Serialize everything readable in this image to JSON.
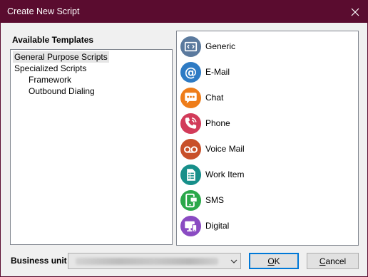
{
  "window": {
    "title": "Create New Script"
  },
  "templates_panel": {
    "header": "Available Templates",
    "tree": [
      {
        "label": "General Purpose Scripts",
        "selected": true,
        "level": 0
      },
      {
        "label": "Specialized Scripts",
        "selected": false,
        "level": 0
      },
      {
        "label": "Framework",
        "selected": false,
        "level": 1
      },
      {
        "label": "Outbound Dialing",
        "selected": false,
        "level": 1
      }
    ]
  },
  "template_list": [
    {
      "label": "Generic",
      "icon": "code-window-icon",
      "color": "#5b7a9e"
    },
    {
      "label": "E-Mail",
      "icon": "at-sign-icon",
      "color": "#2e7bc4"
    },
    {
      "label": "Chat",
      "icon": "chat-bubble-icon",
      "color": "#ee7d1a"
    },
    {
      "label": "Phone",
      "icon": "phone-icon",
      "color": "#d23b5a"
    },
    {
      "label": "Voice Mail",
      "icon": "voicemail-icon",
      "color": "#c8502a"
    },
    {
      "label": "Work Item",
      "icon": "document-list-icon",
      "color": "#178f8a"
    },
    {
      "label": "SMS",
      "icon": "mobile-message-icon",
      "color": "#2ba84a"
    },
    {
      "label": "Digital",
      "icon": "monitor-icon",
      "color": "#8a4bc2"
    }
  ],
  "business_unit": {
    "label": "Business unit"
  },
  "buttons": {
    "ok": {
      "mnemonic": "O",
      "rest": "K"
    },
    "cancel": {
      "mnemonic": "C",
      "rest": "ancel"
    }
  },
  "colors": {
    "title_bar": "#5a0c2f",
    "focus_border": "#0078d7"
  }
}
